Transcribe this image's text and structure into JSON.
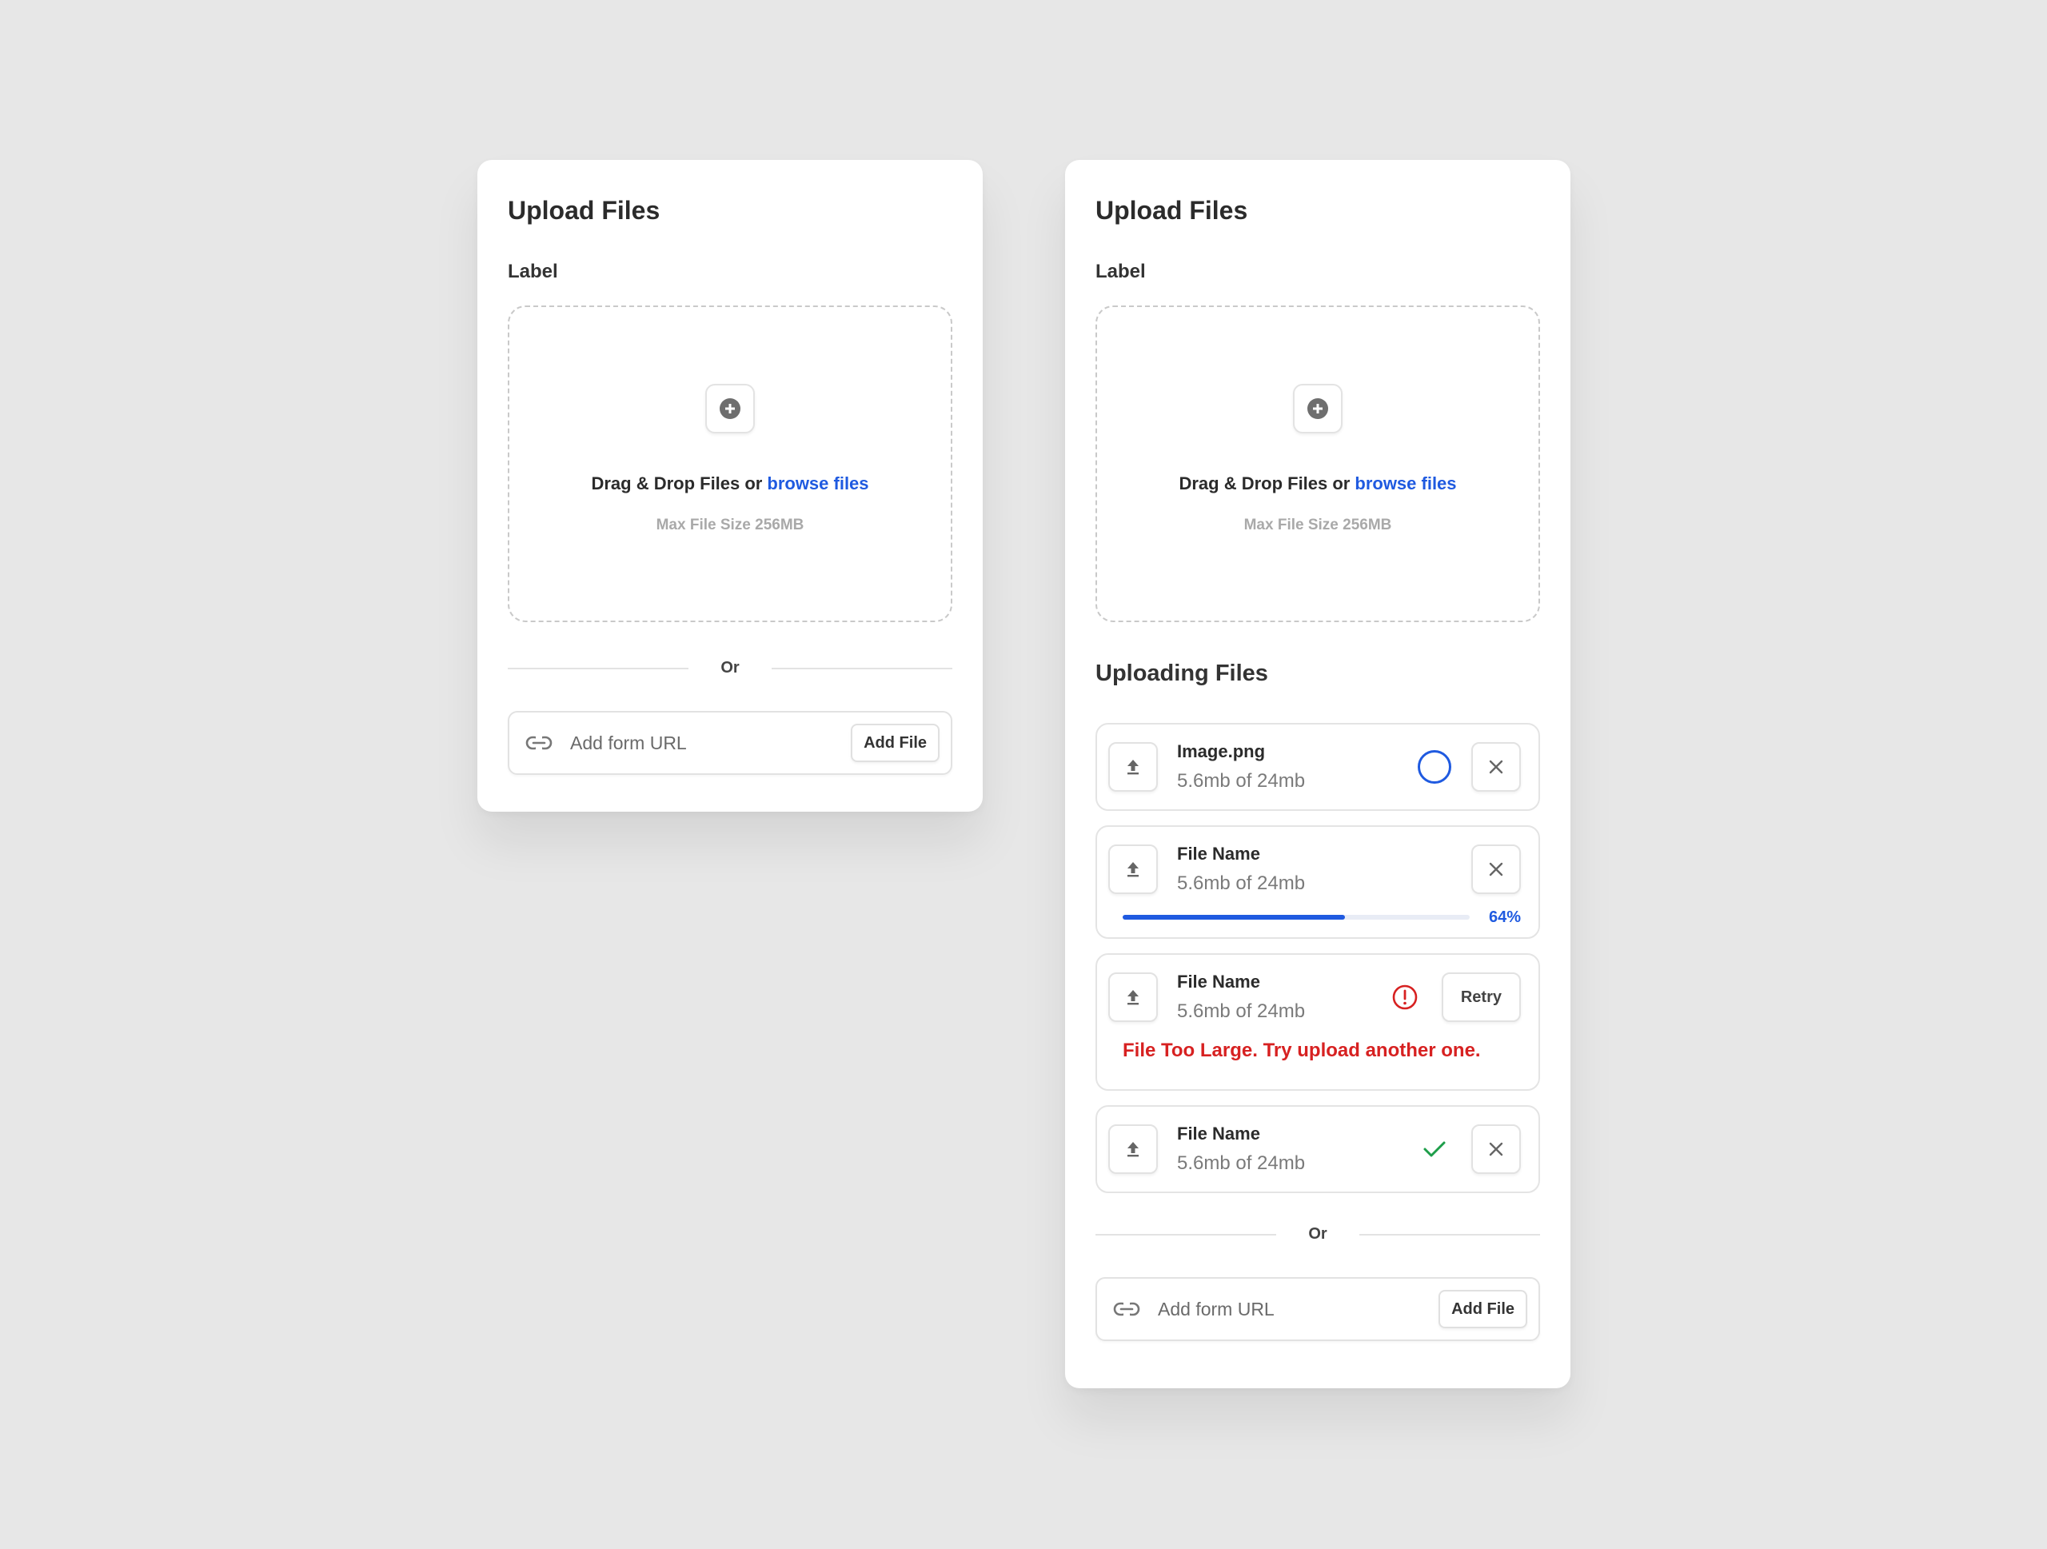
{
  "left_card": {
    "title": "Upload Files",
    "label": "Label",
    "dropzone": {
      "text": "Drag & Drop Files or",
      "browse": "browse files",
      "max_size": "Max File Size 256MB"
    },
    "divider": "Or",
    "url": {
      "placeholder": "Add form URL",
      "button": "Add File"
    }
  },
  "right_card": {
    "title": "Upload Files",
    "label": "Label",
    "dropzone": {
      "text": "Drag & Drop Files or",
      "browse": "browse files",
      "max_size": "Max File Size 256MB"
    },
    "uploading_title": "Uploading Files",
    "files": [
      {
        "name": "Image.png",
        "size": "5.6mb of 24mb",
        "status": "loading"
      },
      {
        "name": "File Name",
        "size": "5.6mb of 24mb",
        "status": "progress",
        "progress": 64,
        "progress_label": "64%"
      },
      {
        "name": "File Name",
        "size": "5.6mb of 24mb",
        "status": "error",
        "error": "File Too Large. Try upload another one.",
        "retry": "Retry"
      },
      {
        "name": "File Name",
        "size": "5.6mb of 24mb",
        "status": "done"
      }
    ],
    "divider": "Or",
    "url": {
      "placeholder": "Add form URL",
      "button": "Add File"
    }
  },
  "colors": {
    "accent": "#1f5ae0",
    "error": "#d72121",
    "success": "#1e9e4a"
  }
}
